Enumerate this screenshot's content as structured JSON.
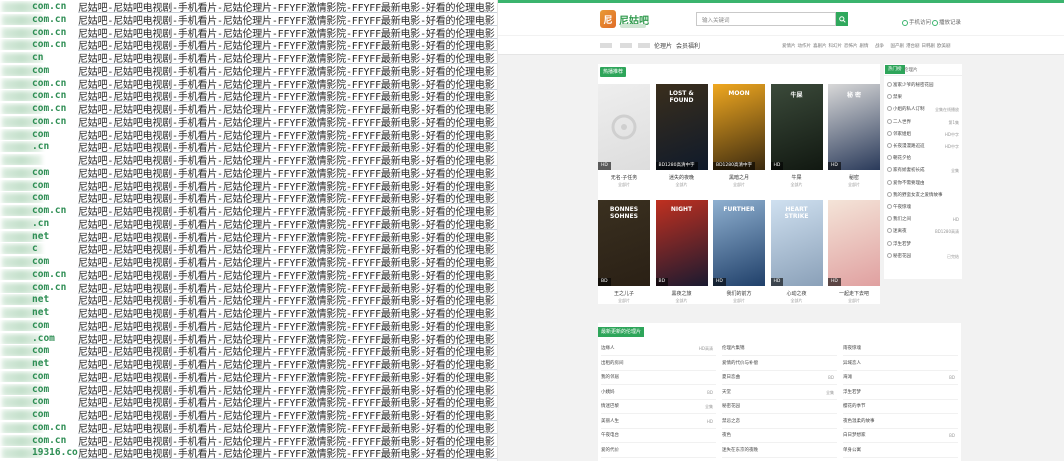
{
  "left": {
    "listing_title": "尼姑吧-尼姑吧电视剧-手机看片-尼姑伦理片-FFYFF激情影院-FFYFF最新电影-好看的伦理电影",
    "rows": [
      {
        "domain": "com.cn"
      },
      {
        "domain": "com.cn"
      },
      {
        "domain": "com.cn"
      },
      {
        "domain": "com.cn"
      },
      {
        "domain": "cn"
      },
      {
        "domain": "com"
      },
      {
        "domain": "com.cn"
      },
      {
        "domain": "com.cn"
      },
      {
        "domain": "com.cn"
      },
      {
        "domain": "com.cn"
      },
      {
        "domain": "com"
      },
      {
        "domain": ".cn"
      },
      {
        "domain": ""
      },
      {
        "domain": "com"
      },
      {
        "domain": "com"
      },
      {
        "domain": "com"
      },
      {
        "domain": "com.cn"
      },
      {
        "domain": ".cn"
      },
      {
        "domain": "net"
      },
      {
        "domain": "c"
      },
      {
        "domain": "com"
      },
      {
        "domain": "com.cn"
      },
      {
        "domain": "com.cn"
      },
      {
        "domain": "net"
      },
      {
        "domain": "net"
      },
      {
        "domain": "com"
      },
      {
        "domain": ".com"
      },
      {
        "domain": "com"
      },
      {
        "domain": "net"
      },
      {
        "domain": "com"
      },
      {
        "domain": "com"
      },
      {
        "domain": "com"
      },
      {
        "domain": "com"
      },
      {
        "domain": "com.cn"
      },
      {
        "domain": "com.cn"
      },
      {
        "domain": "19316.com.cn"
      }
    ]
  },
  "site": {
    "logo_text": "尼姑吧",
    "search_placeholder": "输入关键词",
    "header_links": [
      "手机访问",
      "播放记录"
    ],
    "nav_items": [
      "伦理片",
      "会员福利"
    ],
    "nav_right": [
      "爱情片",
      "动作片",
      "喜剧片",
      "科幻片",
      "恐怖片",
      "剧情",
      "战争",
      "国产剧",
      "港台剧",
      "日韩剧",
      "欧美剧"
    ],
    "section_hot": "热播推荐",
    "movies": [
      {
        "title": "",
        "name": "无名·子任务",
        "sub": "全部片",
        "badge": "HD",
        "color1": "#eeeeee",
        "color2": "#dddddd"
      },
      {
        "title": "LOST & FOUND",
        "name": "迷失的夜晚",
        "sub": "全部片",
        "badge": "BD1280高清中字",
        "color1": "#3a2e1c",
        "color2": "#0f1a2b"
      },
      {
        "title": "MOON",
        "name": "黑暗之月",
        "sub": "全部片",
        "badge": "BD1280高清中字",
        "color1": "#f0a820",
        "color2": "#3b2a10"
      },
      {
        "title": "牛屎",
        "name": "牛屎",
        "sub": "全部片",
        "badge": "HD",
        "color1": "#3b4a3a",
        "color2": "#111811"
      },
      {
        "title": "秘 密",
        "name": "秘密",
        "sub": "全部片",
        "badge": "HD",
        "color1": "#d8d8d8",
        "color2": "#2a3a5a"
      },
      {
        "title": "BONNES SOHNES",
        "name": "王之儿子",
        "sub": "全部片",
        "badge": "BD",
        "color1": "#3a3020",
        "color2": "#2a2015"
      },
      {
        "title": "NIGHT",
        "name": "黑夜之旅",
        "sub": "全部片",
        "badge": "BD",
        "color1": "#c03020",
        "color2": "#1a1a30"
      },
      {
        "title": "FURTHER",
        "name": "我们的前方",
        "sub": "全部片",
        "badge": "HD",
        "color1": "#8fb0d0",
        "color2": "#20406a"
      },
      {
        "title": "HEART STRIKE",
        "name": "心动之夜",
        "sub": "全部片",
        "badge": "HD",
        "color1": "#cfe0f0",
        "color2": "#8aa0b8"
      },
      {
        "title": "",
        "name": "一起走下去吧",
        "sub": "全部片",
        "badge": "HD",
        "color1": "#f4e4d8",
        "color2": "#e0a0a0"
      }
    ],
    "side_tabs": [
      "热门榜",
      "伦理片"
    ],
    "side_items": [
      {
        "name": "富家少爷的秘密花园",
        "right": ""
      },
      {
        "name": "禁果",
        "right": ""
      },
      {
        "name": "小姐的私人订制",
        "right": "全集在线播放"
      },
      {
        "name": "二人世界",
        "right": "第1集"
      },
      {
        "name": "邻家姐姐",
        "right": "HD中字"
      },
      {
        "name": "长夜漫漫路迢迢",
        "right": "HD中字"
      },
      {
        "name": "朝花夕拾",
        "right": ""
      },
      {
        "name": "家有娇妻初长成",
        "right": "全集"
      },
      {
        "name": "爱你不需要理由",
        "right": ""
      },
      {
        "name": "我的野蛮女友之爱情故事",
        "right": ""
      },
      {
        "name": "午夜惊魂",
        "right": ""
      },
      {
        "name": "我们之间",
        "right": "HD"
      },
      {
        "name": "迷离夜",
        "right": "BD1280高清"
      },
      {
        "name": "浮生若梦",
        "right": ""
      },
      {
        "name": "秘密花园",
        "right": "已完结"
      }
    ],
    "section_bottom": "最新更新的伦理片",
    "bottom_cols": [
      [
        {
          "name": "边缘人",
          "right": "HD高清"
        },
        {
          "name": "出租的房间",
          "right": ""
        },
        {
          "name": "我的邻居",
          "right": ""
        },
        {
          "name": "小姨妈",
          "right": "BD"
        },
        {
          "name": "情迷巴黎",
          "right": "全集"
        },
        {
          "name": "美丽人生",
          "right": "HD"
        },
        {
          "name": "午夜电台",
          "right": ""
        },
        {
          "name": "爱的代价",
          "right": ""
        }
      ],
      [
        {
          "name": "伦理片集锦",
          "right": ""
        },
        {
          "name": "爱情的代价与补偿",
          "right": ""
        },
        {
          "name": "夏日恋曲",
          "right": "BD"
        },
        {
          "name": "天堂",
          "right": "全集"
        },
        {
          "name": "秘密花园",
          "right": ""
        },
        {
          "name": "禁忌之恋",
          "right": ""
        },
        {
          "name": "夜色",
          "right": ""
        },
        {
          "name": "迷失在东京的夜晚",
          "right": ""
        }
      ],
      [
        {
          "name": "雨夜惊魂",
          "right": ""
        },
        {
          "name": "异域恋人",
          "right": ""
        },
        {
          "name": "海滩",
          "right": "BD"
        },
        {
          "name": "浮生若梦",
          "right": ""
        },
        {
          "name": "樱花的季节",
          "right": ""
        },
        {
          "name": "夜色温柔的故事",
          "right": ""
        },
        {
          "name": "白日梦想家",
          "right": "BD"
        },
        {
          "name": "单身公寓",
          "right": ""
        }
      ]
    ]
  }
}
